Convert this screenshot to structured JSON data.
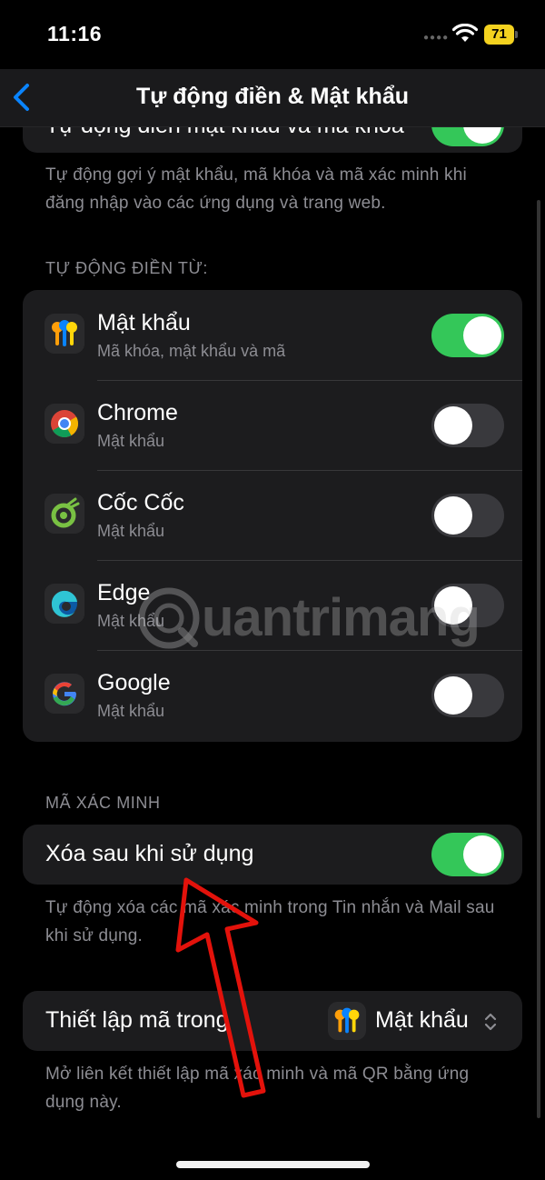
{
  "status_bar": {
    "time": "11:16",
    "battery": "71"
  },
  "nav": {
    "title": "Tự động điền & Mật khẩu"
  },
  "top_partial": {
    "label": "Tự động điền mật khẩu và mã khóa",
    "enabled": true
  },
  "top_footer": "Tự động gợi ý mật khẩu, mã khóa và mã xác minh khi đăng nhập vào các ứng dụng và trang web.",
  "autofill_header": "TỰ ĐỘNG ĐIỀN TỪ:",
  "autofill_sources": [
    {
      "title": "Mật khẩu",
      "subtitle": "Mã khóa, mật khẩu và mã",
      "icon": "passwords-app-icon",
      "enabled": true
    },
    {
      "title": "Chrome",
      "subtitle": "Mật khẩu",
      "icon": "chrome-icon",
      "enabled": false
    },
    {
      "title": "Cốc Cốc",
      "subtitle": "Mật khẩu",
      "icon": "coccoc-icon",
      "enabled": false
    },
    {
      "title": "Edge",
      "subtitle": "Mật khẩu",
      "icon": "edge-icon",
      "enabled": false
    },
    {
      "title": "Google",
      "subtitle": "Mật khẩu",
      "icon": "google-icon",
      "enabled": false
    }
  ],
  "verification_header": "MÃ XÁC MINH",
  "delete_after_use": {
    "label": "Xóa sau khi sử dụng",
    "enabled": true
  },
  "delete_footer": "Tự động xóa các mã xác minh trong Tin nhắn và Mail sau khi sử dụng.",
  "setup_codes": {
    "label": "Thiết lập mã trong",
    "value": "Mật khẩu"
  },
  "setup_footer": "Mở liên kết thiết lập mã xác minh và mã QR bằng ứng dụng này.",
  "watermark": "uantrimang",
  "colors": {
    "toggle_on": "#34c759",
    "accent": "#0a84ff",
    "annotation_arrow": "#e3120b"
  }
}
